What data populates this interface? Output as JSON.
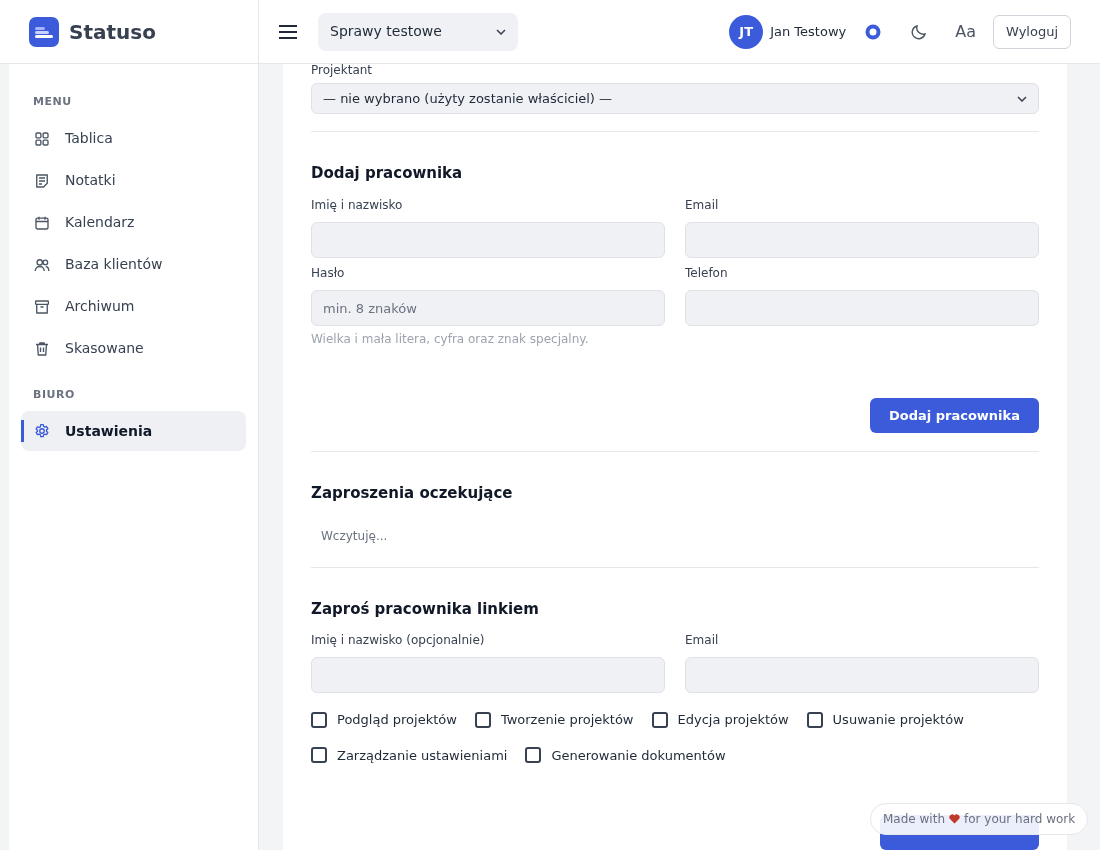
{
  "app": {
    "logo": "Statuso"
  },
  "header": {
    "project_select": "Sprawy testowe",
    "user": {
      "initials": "JT",
      "name": "Jan Testowy"
    },
    "font_toggle": "Aa",
    "logout": "Wyloguj"
  },
  "sidebar": {
    "sections": [
      {
        "title": "MENU",
        "items": [
          {
            "label": "Tablica",
            "selected": false
          },
          {
            "label": "Notatki",
            "selected": false
          },
          {
            "label": "Kalendarz",
            "selected": false
          },
          {
            "label": "Baza klientów",
            "selected": false
          },
          {
            "label": "Archiwum",
            "selected": false
          },
          {
            "label": "Skasowane",
            "selected": false
          }
        ]
      },
      {
        "title": "BIURO",
        "items": [
          {
            "label": "Ustawienia",
            "selected": true
          }
        ]
      }
    ]
  },
  "form": {
    "designer": {
      "label": "Projektant",
      "value": "— nie wybrano (użyty zostanie właściciel) —"
    },
    "add_employee": {
      "title": "Dodaj pracownika",
      "fields": [
        {
          "label": "Imię i nazwisko"
        },
        {
          "label": "Email"
        },
        {
          "label": "Hasło",
          "placeholder": "min. 8 znaków",
          "hint": "Wielka i mała litera, cyfra oraz znak specjalny."
        },
        {
          "label": "Telefon"
        }
      ],
      "button": "Dodaj pracownika"
    },
    "pending_invites": {
      "title": "Zaproszenia oczekujące",
      "status": "Wczytuję..."
    },
    "invite_link": {
      "title": "Zaproś pracownika linkiem",
      "fields": [
        {
          "label": "Imię i nazwisko (opcjonalnie)"
        },
        {
          "label": "Email"
        }
      ],
      "permissions": [
        [
          {
            "label": "Podgląd projektów",
            "checked": false
          },
          {
            "label": "Tworzenie projektów",
            "checked": false
          },
          {
            "label": "Edycja projektów",
            "checked": false
          },
          {
            "label": "Usuwanie projektów",
            "checked": false
          }
        ],
        [
          {
            "label": "Zarządzanie ustawieniami",
            "checked": false
          },
          {
            "label": "Generowanie dokumentów",
            "checked": false
          }
        ]
      ]
    }
  },
  "footer_badge": {
    "before": "Made with",
    "after": "for your hard work"
  }
}
